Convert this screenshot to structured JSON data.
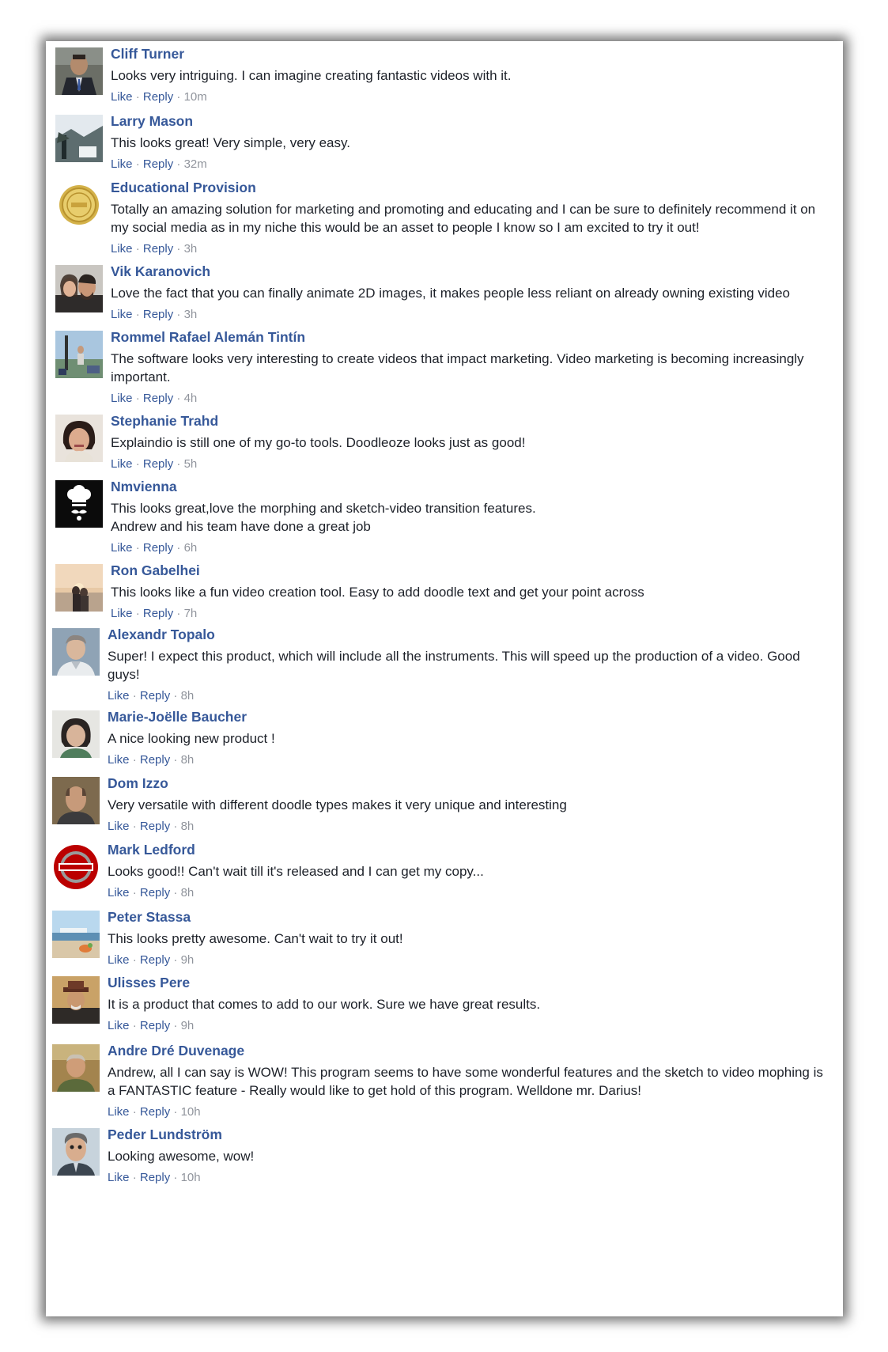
{
  "actions": {
    "like": "Like",
    "reply": "Reply",
    "sep": " · "
  },
  "colors": {
    "name": "#365899",
    "text": "#1d2129",
    "meta": "#90949c"
  },
  "comments": [
    {
      "name": "Cliff Turner",
      "text": "Looks very intriguing. I can imagine creating fantastic videos with it.",
      "time": "10m",
      "avatar": "avatar-man-suit"
    },
    {
      "name": "Larry Mason",
      "text": "This looks great! Very simple, very easy.",
      "time": "32m",
      "avatar": "avatar-landscape"
    },
    {
      "name": "Educational Provision",
      "text": "Totally an amazing solution for marketing and promoting and educating and I can be sure to definitely recommend it on my social media as in my niche this would be an asset to people I know so I am excited to try it out!",
      "time": "3h",
      "avatar": "avatar-gold-seal"
    },
    {
      "name": "Vik Karanovich",
      "text": "Love the fact that you can finally animate 2D images, it makes people less reliant on already owning existing video",
      "time": "3h",
      "avatar": "avatar-couple"
    },
    {
      "name": "Rommel Rafael Alemán Tintín",
      "text": "The software looks very interesting to create videos that impact marketing. Video marketing is becoming increasingly important.",
      "time": "4h",
      "avatar": "avatar-outdoor"
    },
    {
      "name": "Stephanie Trahd",
      "text": "Explaindio is still one of my go-to tools. Doodleoze looks just as good!",
      "time": "5h",
      "avatar": "avatar-woman"
    },
    {
      "name": "Nmvienna",
      "text": "This looks great,love the morphing and sketch-video transition features.\nAndrew and his team have done a great job",
      "time": "6h",
      "avatar": "avatar-chef-icon"
    },
    {
      "name": "Ron Gabelhei",
      "text": "This looks like a fun video creation tool. Easy to add doodle text and get your point across",
      "time": "7h",
      "avatar": "avatar-sunset"
    },
    {
      "name": "Alexandr Topalo",
      "text": "Super! I expect this product, which will include all the instruments. This will speed up the production of a video. Good guys!",
      "time": "8h",
      "avatar": "avatar-man-grey"
    },
    {
      "name": "Marie-Joëlle Baucher",
      "text": "A nice looking new product !",
      "time": "8h",
      "avatar": "avatar-woman-dark"
    },
    {
      "name": "Dom Izzo",
      "text": "Very versatile with different doodle types makes it very unique and interesting",
      "time": "8h",
      "avatar": "avatar-man-bald"
    },
    {
      "name": "Mark Ledford",
      "text": "Looks good!! Can't wait till it's released and I can get my copy...",
      "time": "8h",
      "avatar": "avatar-ohio-state-logo"
    },
    {
      "name": "Peter Stassa",
      "text": "This looks pretty awesome. Can't wait to try it out!",
      "time": "9h",
      "avatar": "avatar-beach"
    },
    {
      "name": "Ulisses Pere",
      "text": "It is a product that comes to add to our work. Sure we have great results.",
      "time": "9h",
      "avatar": "avatar-man-hat"
    },
    {
      "name": "Andre Dré Duvenage",
      "text": "Andrew, all I can say is WOW! This program seems to have some wonderful features and the sketch to video mophing is a FANTASTIC feature - Really would like to get hold of this program. Welldone mr. Darius!",
      "time": "10h",
      "avatar": "avatar-man-outdoor"
    },
    {
      "name": "Peder Lundström",
      "text": "Looking awesome, wow!",
      "time": "10h",
      "avatar": "avatar-man-cartoon"
    }
  ]
}
